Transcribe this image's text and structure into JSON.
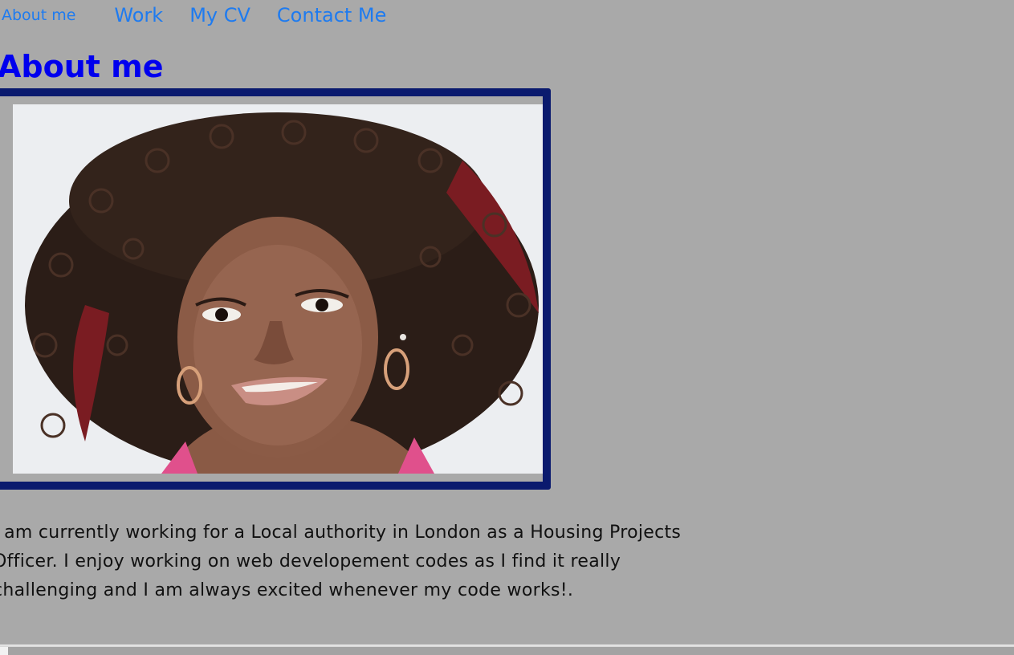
{
  "nav": {
    "items": [
      {
        "label": "About me"
      },
      {
        "label": "Work"
      },
      {
        "label": "My CV"
      },
      {
        "label": "Contact Me"
      }
    ]
  },
  "main": {
    "title": "About me",
    "bio": "I am currently working for a Local authority in London as a Housing Projects Officer. I enjoy working on web developement codes as I find it really challenging and I am always excited whenever my code works!."
  },
  "colors": {
    "background": "#a9a9a9",
    "nav_link": "#1e7bf0",
    "title": "#0000ee",
    "frame_border": "#0a1a6e"
  }
}
